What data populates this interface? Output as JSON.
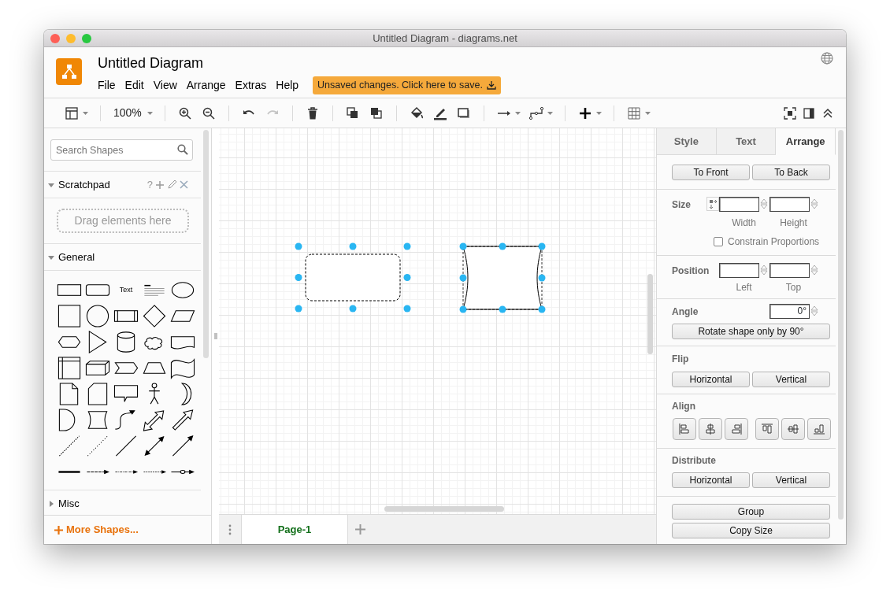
{
  "window": {
    "title": "Untitled Diagram - diagrams.net"
  },
  "app": {
    "document_title": "Untitled Diagram",
    "menu": [
      "File",
      "Edit",
      "View",
      "Arrange",
      "Extras",
      "Help"
    ],
    "save_notice": "Unsaved changes. Click here to save."
  },
  "toolbar": {
    "zoom": "100%",
    "undo": {
      "disabled": false
    },
    "redo": {
      "disabled": true
    }
  },
  "sidebar": {
    "search": {
      "placeholder": "Search Shapes"
    },
    "sections": [
      {
        "kind": "scratchpad",
        "title": "Scratchpad",
        "expanded": true,
        "help": "?",
        "hint": "Drag elements here"
      },
      {
        "kind": "shapes",
        "title": "General",
        "expanded": true,
        "text_shape": "Text"
      },
      {
        "kind": "collapsed",
        "title": "Misc",
        "expanded": false
      }
    ],
    "more_shapes": "More Shapes..."
  },
  "canvas": {
    "shapes": [
      {
        "kind": "rounded-rectangle",
        "selected": true
      },
      {
        "kind": "curved-rectangle",
        "selected": true
      }
    ]
  },
  "pages": [
    {
      "label": "Page-1",
      "selected": true
    }
  ],
  "format_panel": {
    "tabs": [
      {
        "label": "Style",
        "selected": false
      },
      {
        "label": "Text",
        "selected": false
      },
      {
        "label": "Arrange",
        "selected": true
      }
    ],
    "order_buttons": [
      "To Front",
      "To Back"
    ],
    "size": {
      "label": "Size",
      "width_label": "Width",
      "height_label": "Height",
      "constrain": {
        "label": "Constrain Proportions",
        "checked": false
      }
    },
    "position": {
      "label": "Position",
      "left_label": "Left",
      "top_label": "Top"
    },
    "angle": {
      "label": "Angle",
      "value": "0°",
      "rotate_button": "Rotate shape only by 90°"
    },
    "flip": {
      "label": "Flip",
      "buttons": [
        "Horizontal",
        "Vertical"
      ]
    },
    "align": {
      "label": "Align"
    },
    "distribute": {
      "label": "Distribute",
      "buttons": [
        "Horizontal",
        "Vertical"
      ]
    },
    "bottom_buttons": [
      "Group",
      "Copy Size"
    ]
  }
}
